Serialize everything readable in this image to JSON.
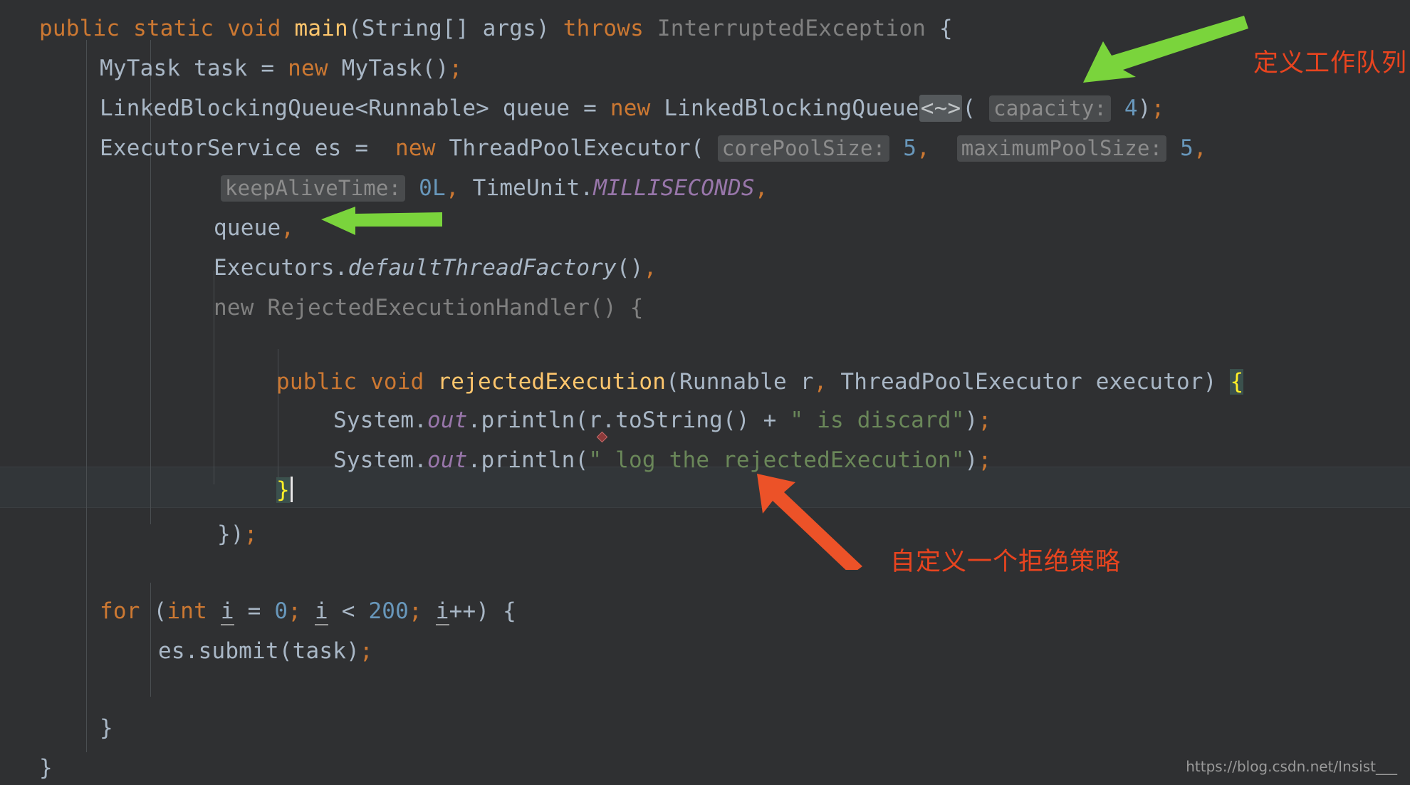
{
  "editor": {
    "background_color": "#2f3032",
    "default_text_color": "#a9b7c6",
    "caret_line_color": "#323639",
    "lines": [
      {
        "n": 1,
        "indent": 0,
        "text": "public static void main(String[] args) throws InterruptedException {"
      },
      {
        "n": 2,
        "indent": 1,
        "text": "MyTask task = new MyTask();"
      },
      {
        "n": 3,
        "indent": 1,
        "text": "LinkedBlockingQueue<Runnable> queue = new LinkedBlockingQueue<~>( capacity: 4);"
      },
      {
        "n": 4,
        "indent": 1,
        "text": "ExecutorService es = new ThreadPoolExecutor( corePoolSize: 5, maximumPoolSize: 5,"
      },
      {
        "n": 5,
        "indent": 3,
        "text": "keepAliveTime: 0L, TimeUnit.MILLISECONDS,"
      },
      {
        "n": 6,
        "indent": 3,
        "text": "queue,"
      },
      {
        "n": 7,
        "indent": 3,
        "text": "Executors.defaultThreadFactory(),"
      },
      {
        "n": 8,
        "indent": 3,
        "text": "new RejectedExecutionHandler() {"
      },
      {
        "n": 9,
        "indent": 0,
        "text": ""
      },
      {
        "n": 10,
        "indent": 4,
        "text": "public void rejectedExecution(Runnable r, ThreadPoolExecutor executor) {"
      },
      {
        "n": 11,
        "indent": 5,
        "text": "System.out.println(r.toString() + \" is discard\");"
      },
      {
        "n": 12,
        "indent": 5,
        "text": "System.out.println(\" log the rejectedExecution\");"
      },
      {
        "n": 13,
        "indent": 4,
        "text": "}"
      },
      {
        "n": 14,
        "indent": 3,
        "text": "});"
      },
      {
        "n": 15,
        "indent": 0,
        "text": ""
      },
      {
        "n": 16,
        "indent": 1,
        "text": "for (int i = 0; i < 200; i++) {"
      },
      {
        "n": 17,
        "indent": 2,
        "text": "es.submit(task);"
      },
      {
        "n": 18,
        "indent": 0,
        "text": ""
      },
      {
        "n": 19,
        "indent": 1,
        "text": "}"
      },
      {
        "n": 20,
        "indent": 0,
        "text": "}"
      }
    ],
    "inlay_hints": [
      {
        "label": "capacity:",
        "value": "4"
      },
      {
        "label": "corePoolSize:",
        "value": "5"
      },
      {
        "label": "maximumPoolSize:",
        "value": "5"
      },
      {
        "label": "keepAliveTime:",
        "value": "0L"
      }
    ],
    "tokens": {
      "keywords": [
        "public",
        "static",
        "void",
        "new",
        "throws",
        "for",
        "int"
      ],
      "method_declaration": "rejectedExecution",
      "string_literals": [
        "\" is discard\"",
        "\" log the rejectedExecution\""
      ],
      "numbers": [
        "4",
        "5",
        "5",
        "0L",
        "0",
        "200"
      ],
      "static_fields": [
        "MILLISECONDS",
        "out"
      ],
      "folded_generic": "<~>",
      "matched_brace": "}"
    },
    "colors": {
      "keyword": "#cc7832",
      "identifier": "#a9b7c6",
      "method": "#ffc66d",
      "number": "#6897bb",
      "string": "#6a8759",
      "static_field": "#9876aa",
      "dimmed": "#808080",
      "brace_highlight": "#ffef28",
      "inlay_hint_bg": "#494b4d",
      "inlay_hint_fg": "#8c8c8c"
    }
  },
  "annotations": {
    "color": "#e8441f",
    "arrow_green_color": "#7ad43c",
    "arrow_red_color": "#ec5228",
    "notes": [
      {
        "id": "note-work-queue",
        "text": "定义工作队列"
      },
      {
        "id": "note-reject-policy",
        "text": "自定义一个拒绝策略"
      }
    ],
    "arrows": [
      {
        "id": "arrow-to-queue-capacity",
        "color": "green",
        "points_to": "LinkedBlockingQueue capacity argument"
      },
      {
        "id": "arrow-to-queue-param",
        "color": "green",
        "points_to": "queue parameter"
      },
      {
        "id": "arrow-to-reject-handler",
        "color": "red",
        "points_to": "rejectedExecution body"
      }
    ]
  },
  "watermark": {
    "text": "https://blog.csdn.net/Insist___"
  }
}
